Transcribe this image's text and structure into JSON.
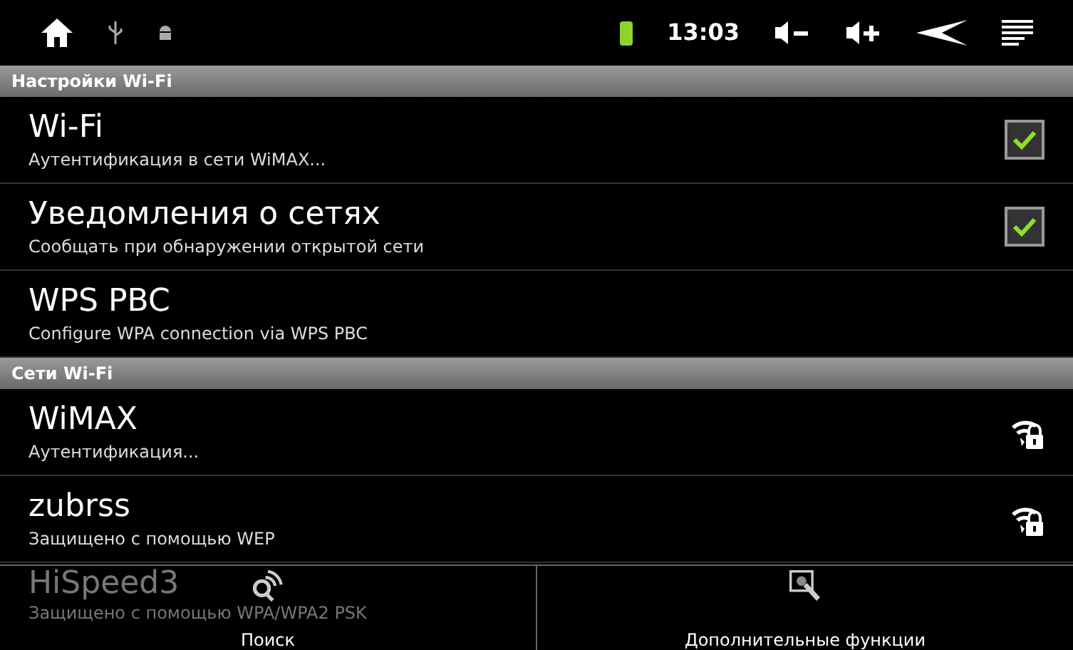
{
  "status_bar": {
    "time": "13:03"
  },
  "sections": [
    {
      "title": "Настройки Wi-Fi",
      "items": [
        {
          "kind": "checkbox",
          "title": "Wi-Fi",
          "subtitle": "Аутентификация в сети WiMAX...",
          "checked": true
        },
        {
          "kind": "checkbox",
          "title": "Уведомления о сетях",
          "subtitle": "Сообщать при обнаружении открытой сети",
          "checked": true
        },
        {
          "kind": "plain",
          "title": "WPS PBC",
          "subtitle": "Configure WPA connection via WPS PBC"
        }
      ]
    },
    {
      "title": "Сети Wi-Fi",
      "items": [
        {
          "kind": "network",
          "title": "WiMAX",
          "subtitle": "Аутентификация..."
        },
        {
          "kind": "network",
          "title": "zubrss",
          "subtitle": "Защищено с помощью WEP"
        },
        {
          "kind": "network",
          "title": "HiSpeed3",
          "subtitle": "Защищено с помощью WPA/WPA2 PSK",
          "disabled": true
        }
      ]
    }
  ],
  "menu": [
    {
      "kind": "search",
      "label": "Поиск"
    },
    {
      "kind": "advanced",
      "label": "Дополнительные функции"
    }
  ]
}
